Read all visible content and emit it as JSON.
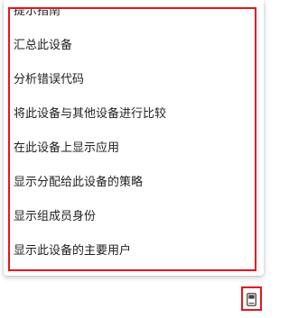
{
  "menu": {
    "items": [
      {
        "label": "提示指南"
      },
      {
        "label": "汇总此设备"
      },
      {
        "label": "分析错误代码"
      },
      {
        "label": "将此设备与其他设备进行比较"
      },
      {
        "label": "在此设备上显示应用"
      },
      {
        "label": "显示分配给此设备的策略"
      },
      {
        "label": "显示组成员身份"
      },
      {
        "label": "显示此设备的主要用户"
      }
    ]
  },
  "device_button": {
    "icon": "device-icon"
  },
  "colors": {
    "highlight_border": "#e8141e",
    "text": "#1f1f1f",
    "background": "#ffffff"
  }
}
